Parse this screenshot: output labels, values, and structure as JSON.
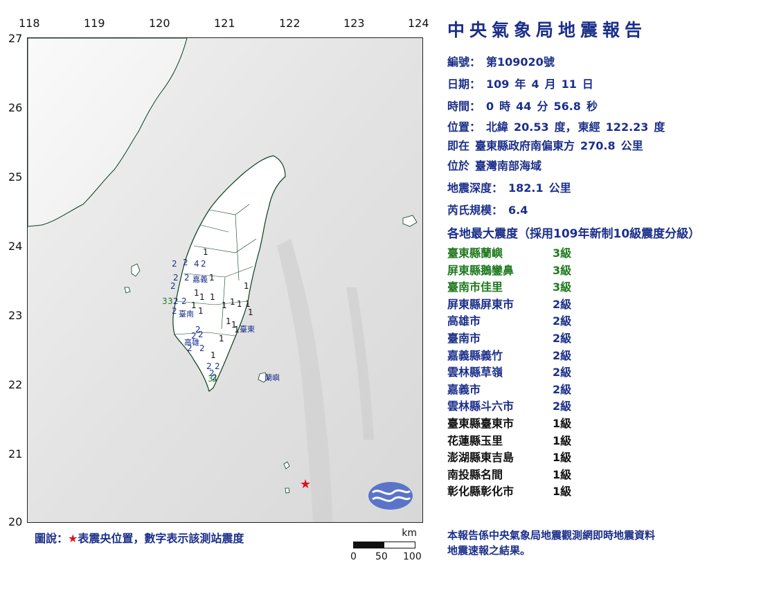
{
  "map": {
    "lon_labels": [
      "118",
      "119",
      "120",
      "121",
      "122",
      "123",
      "124"
    ],
    "lat_labels": [
      "27",
      "26",
      "25",
      "24",
      "23",
      "22",
      "21",
      "20"
    ],
    "place_labels": {
      "chiayi": "嘉義",
      "tainan": "臺南",
      "kaohsiung": "高雄",
      "taitung": "臺東",
      "lanyu": "蘭嶼"
    },
    "station_values": [
      "1",
      "2",
      "2",
      "4",
      "2",
      "2",
      "2",
      "嘉義",
      "1",
      "2",
      "1",
      "1",
      "1",
      "1",
      "3",
      "3",
      "2",
      "2",
      "1",
      "1",
      "1",
      "1",
      "2",
      "臺南",
      "1",
      "1",
      "1",
      "1",
      "2",
      "2",
      "2",
      "2",
      "1",
      "2",
      "高雄",
      "1",
      "2",
      "2",
      "2",
      "2",
      "3",
      "3",
      "1",
      "1"
    ],
    "epicenter": {
      "lon": 122.23,
      "lat": 20.53,
      "color": "#e0101a"
    },
    "cwb_logo": "cwb-logo-icon"
  },
  "legend": {
    "prefix": "圖說：",
    "star": "★",
    "text": "表震央位置，數字表示該測站震度"
  },
  "scale_bar": {
    "unit": "km",
    "ticks": [
      "0",
      "50",
      "100"
    ]
  },
  "report": {
    "title": "中央氣象局地震報告",
    "number_label": "編號：",
    "number_value": "第109020號",
    "date_label": "日期：",
    "date_year": "109",
    "date_year_unit": "年",
    "date_month": "4",
    "date_month_unit": "月",
    "date_day": "11",
    "date_day_unit": "日",
    "time_label": "時間：",
    "time_h": "0",
    "time_h_unit": "時",
    "time_m": "44",
    "time_m_unit": "分",
    "time_s": "56.8",
    "time_s_unit": "秒",
    "location_label": "位置：",
    "location_lat_label": "北緯",
    "location_lat": "20.53",
    "location_lat_unit": "度，",
    "location_lon_label": "東經",
    "location_lon": "122.23",
    "location_lon_unit": "度",
    "relative_label": "即在",
    "relative_text": "臺東縣政府南偏東方",
    "relative_dist": "270.8",
    "relative_unit": "公里",
    "region_label": "位於",
    "region_text": "臺灣南部海域",
    "depth_label": "地震深度：",
    "depth_value": "182.1",
    "depth_unit": "公里",
    "magnitude_label": "芮氏規模：",
    "magnitude_value": "6.4",
    "intensity_heading": "各地最大震度（採用109年新制10級震度分級）"
  },
  "stations": [
    {
      "name": "臺東縣蘭嶼",
      "level": "3級",
      "color": "#1f7a1f"
    },
    {
      "name": "屏東縣鵝鑾鼻",
      "level": "3級",
      "color": "#1f7a1f"
    },
    {
      "name": "臺南市佳里",
      "level": "3級",
      "color": "#1f7a1f"
    },
    {
      "name": "屏東縣屏東市",
      "level": "2級",
      "color": "#1b2f8a"
    },
    {
      "name": "高雄市",
      "level": "2級",
      "color": "#1b2f8a"
    },
    {
      "name": "臺南市",
      "level": "2級",
      "color": "#1b2f8a"
    },
    {
      "name": "嘉義縣義竹",
      "level": "2級",
      "color": "#1b2f8a"
    },
    {
      "name": "雲林縣草嶺",
      "level": "2級",
      "color": "#1b2f8a"
    },
    {
      "name": "嘉義市",
      "level": "2級",
      "color": "#1b2f8a"
    },
    {
      "name": "雲林縣斗六市",
      "level": "2級",
      "color": "#1b2f8a"
    },
    {
      "name": "臺東縣臺東市",
      "level": "1級",
      "color": "#111111"
    },
    {
      "name": "花蓮縣玉里",
      "level": "1級",
      "color": "#111111"
    },
    {
      "name": "澎湖縣東吉島",
      "level": "1級",
      "color": "#111111"
    },
    {
      "name": "南投縣名間",
      "level": "1級",
      "color": "#111111"
    },
    {
      "name": "彰化縣彰化市",
      "level": "1級",
      "color": "#111111"
    }
  ],
  "footer": {
    "line1": "本報告係中央氣象局地震觀測網即時地震資料",
    "line2": "地震速報之結果。"
  }
}
